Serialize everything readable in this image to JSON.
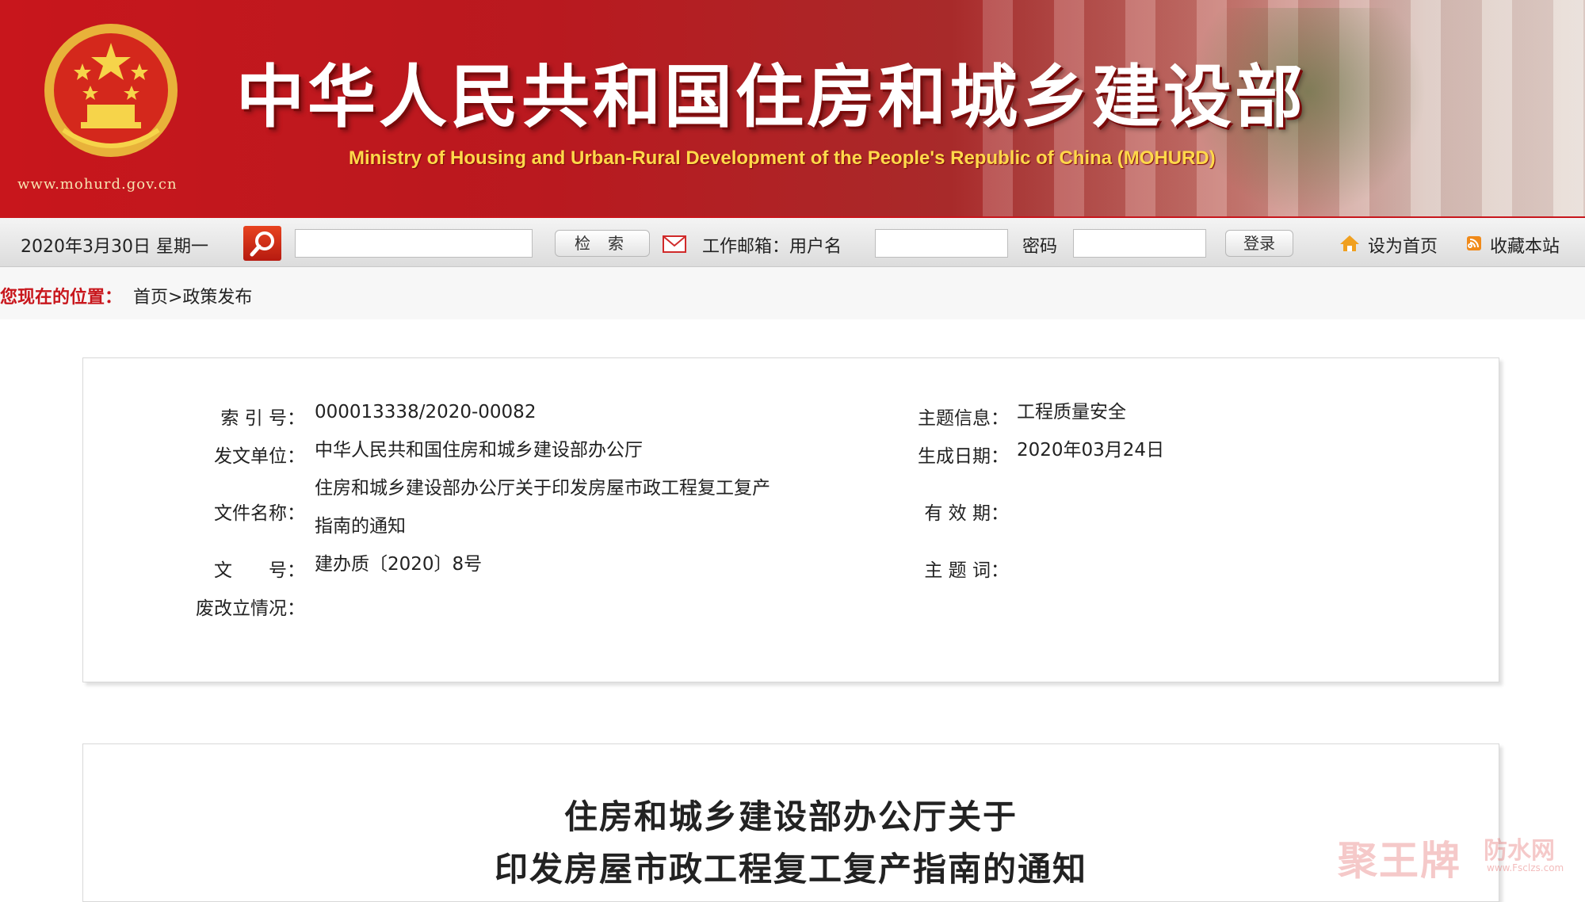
{
  "banner": {
    "title": "中华人民共和国住房和城乡建设部",
    "subtitle": "Ministry of Housing and Urban-Rural Development of the People's Republic of China (MOHURD)",
    "site_url": "www.mohurd.gov.cn"
  },
  "toolbar": {
    "date": "2020年3月30日 星期一",
    "search_button": "检索",
    "mailbox_label": "工作邮箱：用户名",
    "password_label": "密码",
    "login_button": "登录",
    "set_home": "设为首页",
    "add_favorite": "收藏本站"
  },
  "breadcrumb": {
    "label": "您现在的位置：",
    "path": "首页>政策发布"
  },
  "meta": {
    "index_label": "索 引 号：",
    "index_value": "000013338/2020-00082",
    "topic_label": "主题信息：",
    "topic_value": "工程质量安全",
    "issuer_label": "发文单位：",
    "issuer_value": "中华人民共和国住房和城乡建设部办公厅",
    "date_label": "生成日期：",
    "date_value": "2020年03月24日",
    "filename_label": "文件名称：",
    "filename_line1": "住房和城乡建设部办公厅关于印发房屋市政工程复工复产",
    "filename_line2": "指南的通知",
    "validity_label": "有 效 期：",
    "docno_label": "文　　号：",
    "docno_value": "建办质〔2020〕8号",
    "keywords_label": "主 题 词：",
    "status_label": "废改立情况："
  },
  "document": {
    "title_line1": "住房和城乡建设部办公厅关于",
    "title_line2": "印发房屋市政工程复工复产指南的通知"
  },
  "watermark": {
    "main": "聚王牌",
    "side": "防水网",
    "url": "www.Fsclzs.com"
  },
  "colors": {
    "brand_red": "#c8161c",
    "gold": "#ffd94a"
  }
}
